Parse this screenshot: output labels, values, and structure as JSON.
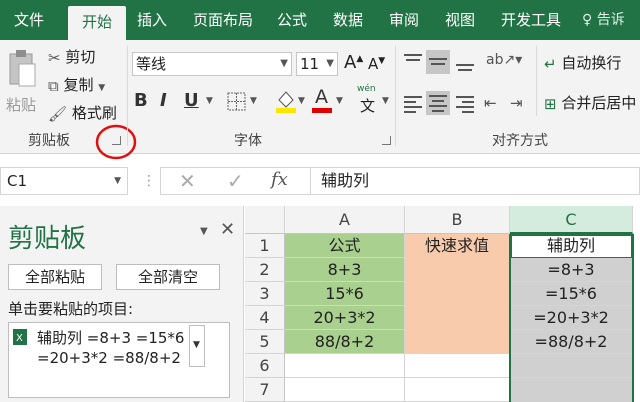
{
  "tabs": [
    "文件",
    "开始",
    "插入",
    "页面布局",
    "公式",
    "数据",
    "审阅",
    "视图",
    "开发工具"
  ],
  "active_tab": "开始",
  "tell_me": "告诉",
  "clipboard_group": {
    "paste": "粘贴",
    "cut": "剪切",
    "copy": "复制",
    "format_painter": "格式刷",
    "label": "剪贴板"
  },
  "font_group": {
    "font_name": "等线",
    "font_size": "11",
    "label": "字体",
    "bold": "B",
    "italic": "I",
    "underline": "U",
    "phonetic": "wén"
  },
  "align_group": {
    "wrap_text": "自动换行",
    "merge_center": "合并后居中",
    "label": "对齐方式"
  },
  "formula_bar": {
    "name_box": "C1",
    "fx": "fx",
    "content": "辅助列"
  },
  "clipboard_pane": {
    "title": "剪贴板",
    "paste_all": "全部粘贴",
    "clear_all": "全部清空",
    "hint": "单击要粘贴的项目:",
    "item_line1": "辅助列 =8+3 =15*6",
    "item_line2": "=20+3*2 =88/8+2"
  },
  "colors": {
    "accent": "#217346",
    "green_fill": "#a9d08e",
    "orange_fill": "#f8cbad",
    "gray_fill": "#d0d0d0"
  },
  "grid": {
    "columns": [
      "A",
      "B",
      "C"
    ],
    "rows": [
      "1",
      "2",
      "3",
      "4",
      "5",
      "6",
      "7"
    ],
    "cells": [
      [
        "公式",
        "快速求值",
        "辅助列"
      ],
      [
        "8+3",
        "",
        "=8+3"
      ],
      [
        "15*6",
        "",
        "=15*6"
      ],
      [
        "20+3*2",
        "",
        "=20+3*2"
      ],
      [
        "88/8+2",
        "",
        "=88/8+2"
      ],
      [
        "",
        "",
        ""
      ],
      [
        "",
        "",
        ""
      ]
    ]
  }
}
